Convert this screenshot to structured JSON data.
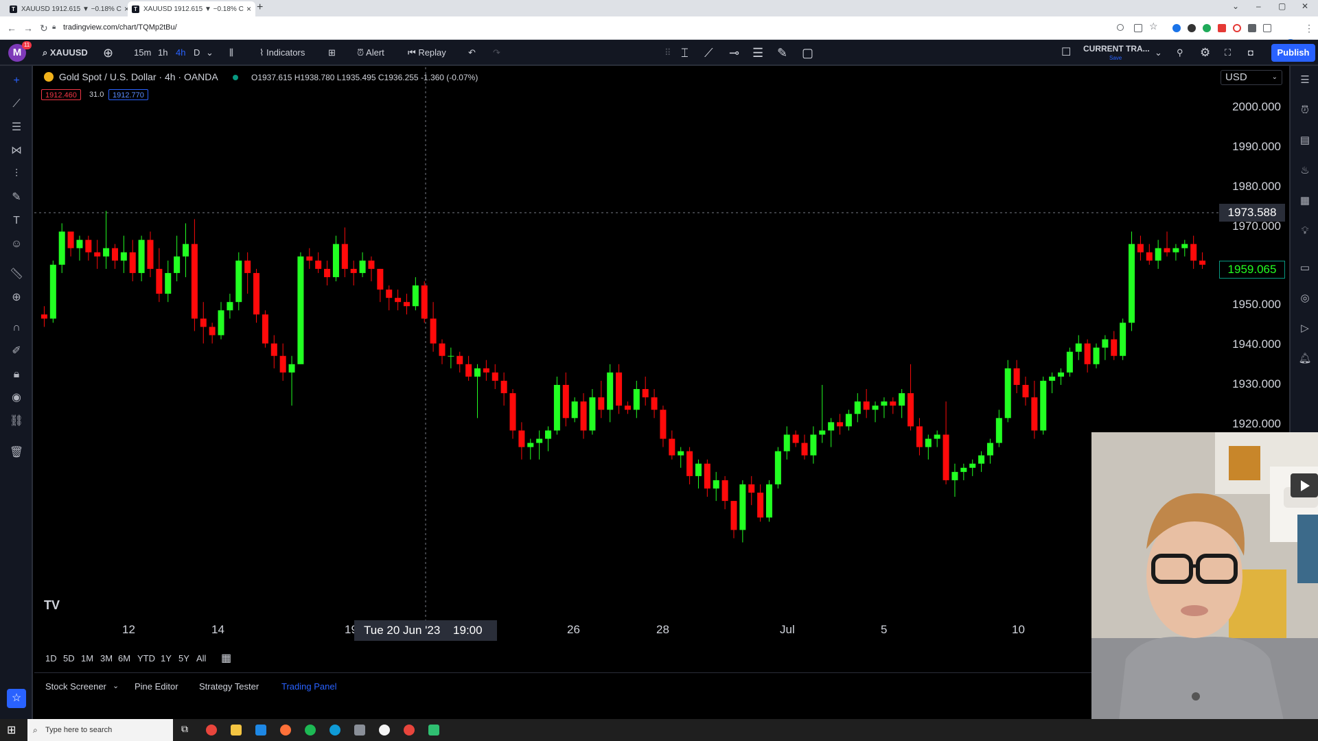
{
  "browser": {
    "tabs": [
      {
        "title": "XAUUSD 1912.615 ▼ −0.18% CU"
      },
      {
        "title": "XAUUSD 1912.615 ▼ −0.18% CU"
      }
    ],
    "url": "tradingview.com/chart/TQMp2tBu/"
  },
  "toolbar": {
    "avatar_letter": "M",
    "notification_count": "11",
    "symbol": "XAUUSD",
    "intervals": [
      "15m",
      "1h",
      "4h",
      "D"
    ],
    "active_interval": "4h",
    "indicators_label": "Indicators",
    "alert_label": "Alert",
    "replay_label": "Replay",
    "layout_name": "CURRENT TRA...",
    "layout_status": "Save",
    "publish_label": "Publish"
  },
  "legend": {
    "title": "Gold Spot / U.S. Dollar · 4h · OANDA",
    "open": "O1937.615",
    "high": "H1938.780",
    "low": "L1935.495",
    "close": "C1936.255",
    "change": "-1.360 (-0.07%)",
    "bid": "1912.460",
    "spread": "31.0",
    "ask": "1912.770"
  },
  "currency": "USD",
  "chart_data": {
    "type": "candlestick",
    "y_ticks": [
      "2000.000",
      "1990.000",
      "1980.000",
      "1970.000",
      "1950.000",
      "1940.000",
      "1930.000",
      "1920.000"
    ],
    "x_ticks": [
      "12",
      "14",
      "19",
      "26",
      "28",
      "Jul",
      "5",
      "10"
    ],
    "ylim": [
      1905,
      2005
    ],
    "cursor_price": "1973.588",
    "last_price": "1959.065",
    "cursor_date": "Tue 20 Jun '23",
    "cursor_time": "19:00",
    "colors": {
      "up": "#22ff22",
      "down": "#ff0a0a",
      "background": "#000000"
    },
    "candles": [
      [
        1947,
        1949,
        1944,
        1946
      ],
      [
        1946,
        1960,
        1945,
        1959
      ],
      [
        1959,
        1969,
        1957,
        1967
      ],
      [
        1967,
        1967,
        1961,
        1963
      ],
      [
        1963,
        1966,
        1960,
        1965
      ],
      [
        1965,
        1966,
        1960,
        1962
      ],
      [
        1962,
        1965,
        1958,
        1961
      ],
      [
        1961,
        1972,
        1958,
        1963
      ],
      [
        1963,
        1964,
        1958,
        1960
      ],
      [
        1960,
        1966,
        1957,
        1962
      ],
      [
        1962,
        1965,
        1955,
        1957
      ],
      [
        1957,
        1966,
        1955,
        1965
      ],
      [
        1965,
        1967,
        1956,
        1958
      ],
      [
        1958,
        1963,
        1950,
        1952
      ],
      [
        1952,
        1960,
        1950,
        1957
      ],
      [
        1957,
        1966,
        1955,
        1961
      ],
      [
        1961,
        1969,
        1956,
        1964
      ],
      [
        1964,
        1970,
        1943,
        1946
      ],
      [
        1946,
        1950,
        1940,
        1944
      ],
      [
        1944,
        1945,
        1940,
        1942
      ],
      [
        1942,
        1950,
        1941,
        1948
      ],
      [
        1948,
        1952,
        1946,
        1950
      ],
      [
        1950,
        1962,
        1948,
        1960
      ],
      [
        1960,
        1962,
        1952,
        1957
      ],
      [
        1957,
        1958,
        1945,
        1947
      ],
      [
        1947,
        1948,
        1939,
        1940
      ],
      [
        1940,
        1942,
        1934,
        1937
      ],
      [
        1937,
        1940,
        1931,
        1933
      ],
      [
        1933,
        1937,
        1925,
        1935
      ],
      [
        1935,
        1962,
        1935,
        1961
      ],
      [
        1961,
        1963,
        1958,
        1960
      ],
      [
        1960,
        1962,
        1957,
        1958
      ],
      [
        1958,
        1960,
        1954,
        1956
      ],
      [
        1956,
        1966,
        1955,
        1964
      ],
      [
        1964,
        1968,
        1956,
        1958
      ],
      [
        1958,
        1960,
        1954,
        1957
      ],
      [
        1957,
        1962,
        1956,
        1960
      ],
      [
        1960,
        1961,
        1955,
        1958
      ],
      [
        1958,
        1958,
        1950,
        1953
      ],
      [
        1953,
        1954,
        1948,
        1951
      ],
      [
        1951,
        1953,
        1948,
        1950
      ],
      [
        1950,
        1952,
        1947,
        1949
      ],
      [
        1949,
        1956,
        1948,
        1954
      ],
      [
        1954,
        1955,
        1945,
        1946
      ],
      [
        1946,
        1950,
        1938,
        1940
      ],
      [
        1940,
        1941,
        1935,
        1937
      ],
      [
        1937,
        1939,
        1934,
        1937
      ],
      [
        1937,
        1938,
        1933,
        1935
      ],
      [
        1935,
        1937,
        1931,
        1932
      ],
      [
        1932,
        1935,
        1922,
        1934
      ],
      [
        1934,
        1936,
        1931,
        1933
      ],
      [
        1933,
        1935,
        1929,
        1931
      ],
      [
        1931,
        1933,
        1925,
        1928
      ],
      [
        1928,
        1929,
        1917,
        1919
      ],
      [
        1919,
        1921,
        1912,
        1915
      ],
      [
        1915,
        1917,
        1912,
        1916
      ],
      [
        1916,
        1919,
        1912,
        1917
      ],
      [
        1917,
        1920,
        1914,
        1919
      ],
      [
        1919,
        1932,
        1918,
        1930
      ],
      [
        1930,
        1933,
        1920,
        1922
      ],
      [
        1922,
        1927,
        1921,
        1926
      ],
      [
        1926,
        1928,
        1917,
        1919
      ],
      [
        1919,
        1929,
        1918,
        1927
      ],
      [
        1927,
        1931,
        1922,
        1924
      ],
      [
        1924,
        1935,
        1921,
        1933
      ],
      [
        1933,
        1935,
        1923,
        1925
      ],
      [
        1925,
        1926,
        1923,
        1924
      ],
      [
        1924,
        1931,
        1922,
        1929
      ],
      [
        1929,
        1932,
        1925,
        1927
      ],
      [
        1927,
        1929,
        1922,
        1924
      ],
      [
        1924,
        1925,
        1915,
        1917
      ],
      [
        1917,
        1919,
        1912,
        1913
      ],
      [
        1913,
        1915,
        1910,
        1914
      ],
      [
        1914,
        1915,
        1906,
        1908
      ],
      [
        1908,
        1912,
        1905,
        1911
      ],
      [
        1911,
        1912,
        1903,
        1905
      ],
      [
        1905,
        1909,
        1902,
        1907
      ],
      [
        1907,
        1908,
        1900,
        1902
      ],
      [
        1902,
        1902,
        1893,
        1895
      ],
      [
        1895,
        1907,
        1892,
        1906
      ],
      [
        1906,
        1908,
        1901,
        1904
      ],
      [
        1904,
        1906,
        1897,
        1898
      ],
      [
        1898,
        1907,
        1897,
        1906
      ],
      [
        1906,
        1915,
        1905,
        1914
      ],
      [
        1914,
        1920,
        1912,
        1918
      ],
      [
        1918,
        1919,
        1915,
        1916
      ],
      [
        1916,
        1918,
        1912,
        1913
      ],
      [
        1913,
        1920,
        1911,
        1918
      ],
      [
        1918,
        1930,
        1916,
        1919
      ],
      [
        1919,
        1922,
        1915,
        1921
      ],
      [
        1921,
        1923,
        1918,
        1920
      ],
      [
        1920,
        1924,
        1919,
        1923
      ],
      [
        1923,
        1928,
        1921,
        1926
      ],
      [
        1926,
        1929,
        1922,
        1924
      ],
      [
        1924,
        1926,
        1921,
        1925
      ],
      [
        1925,
        1927,
        1922,
        1926
      ],
      [
        1926,
        1927,
        1923,
        1925
      ],
      [
        1925,
        1929,
        1922,
        1928
      ],
      [
        1928,
        1935,
        1919,
        1920
      ],
      [
        1920,
        1922,
        1913,
        1915
      ],
      [
        1915,
        1918,
        1912,
        1917
      ],
      [
        1917,
        1919,
        1915,
        1918
      ],
      [
        1918,
        1926,
        1906,
        1907
      ],
      [
        1907,
        1911,
        1903,
        1909
      ],
      [
        1909,
        1911,
        1907,
        1910
      ],
      [
        1910,
        1912,
        1908,
        1911
      ],
      [
        1911,
        1914,
        1909,
        1913
      ],
      [
        1913,
        1917,
        1911,
        1916
      ],
      [
        1916,
        1924,
        1915,
        1922
      ],
      [
        1922,
        1936,
        1921,
        1934
      ],
      [
        1934,
        1936,
        1928,
        1930
      ],
      [
        1930,
        1932,
        1925,
        1927
      ],
      [
        1927,
        1931,
        1917,
        1919
      ],
      [
        1919,
        1932,
        1918,
        1931
      ],
      [
        1931,
        1933,
        1928,
        1932
      ],
      [
        1932,
        1934,
        1930,
        1933
      ],
      [
        1933,
        1939,
        1932,
        1938
      ],
      [
        1938,
        1942,
        1936,
        1940
      ],
      [
        1940,
        1941,
        1933,
        1935
      ],
      [
        1935,
        1940,
        1934,
        1939
      ],
      [
        1939,
        1942,
        1936,
        1941
      ],
      [
        1941,
        1943,
        1936,
        1937
      ],
      [
        1937,
        1946,
        1936,
        1945
      ],
      [
        1945,
        1967,
        1943,
        1964
      ],
      [
        1964,
        1966,
        1960,
        1962
      ],
      [
        1962,
        1964,
        1959,
        1960
      ],
      [
        1960,
        1965,
        1958,
        1963
      ],
      [
        1963,
        1967,
        1961,
        1962
      ],
      [
        1962,
        1964,
        1960,
        1963
      ],
      [
        1963,
        1965,
        1961,
        1964
      ],
      [
        1964,
        1966,
        1958,
        1960
      ],
      [
        1960,
        1962,
        1958,
        1959
      ]
    ]
  },
  "range_buttons": [
    "1D",
    "5D",
    "1M",
    "3M",
    "6M",
    "YTD",
    "1Y",
    "5Y",
    "All"
  ],
  "bottom_tabs": [
    "Stock Screener",
    "Pine Editor",
    "Strategy Tester",
    "Trading Panel"
  ],
  "active_bottom_tab": "Trading Panel",
  "taskbar": {
    "search_placeholder": "Type here to search"
  }
}
